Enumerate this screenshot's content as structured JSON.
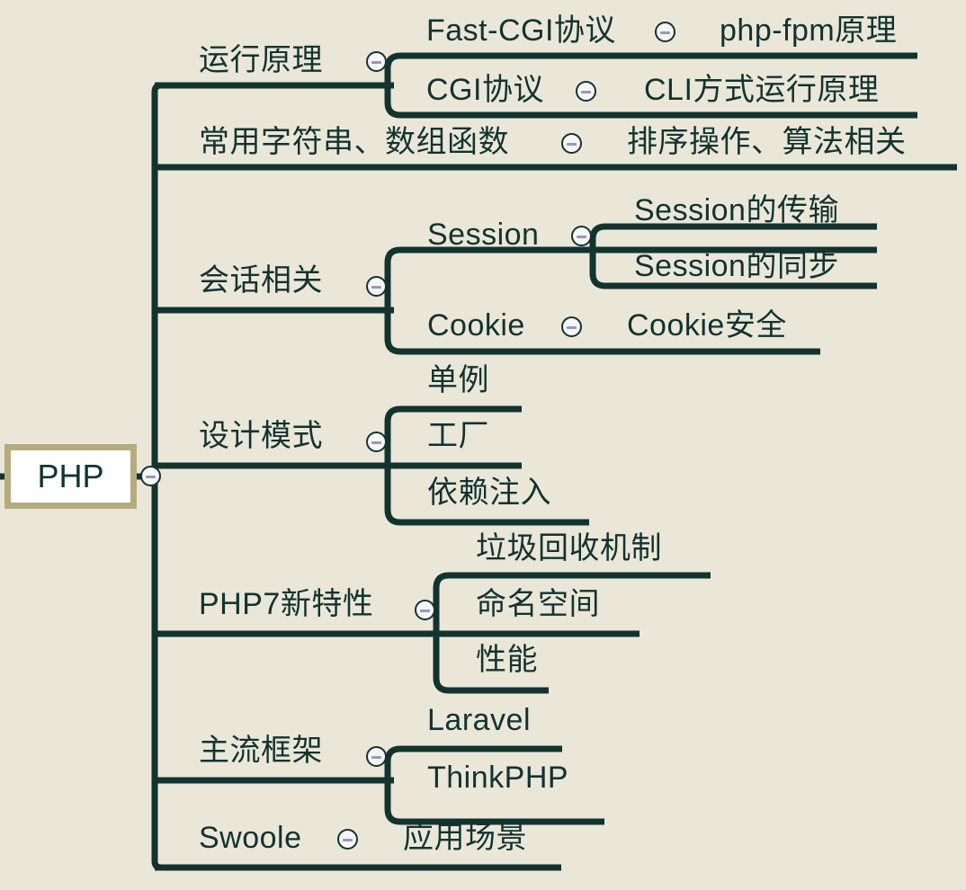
{
  "document": {
    "type": "mind-map",
    "title": "PHP",
    "background_color": "#eae7d9",
    "line_color": "#13332f",
    "text_color": "#13332f",
    "root_fill_color": "#ffffff",
    "root_border_color": "#b5ac7e",
    "toggle_icon": "collapse-minus-icon"
  },
  "root": {
    "label": "PHP"
  },
  "branches": [
    {
      "label": "运行原理",
      "children": [
        {
          "label": "Fast-CGI协议",
          "children": [
            {
              "label": "php-fpm原理"
            }
          ]
        },
        {
          "label": "CGI协议",
          "children": [
            {
              "label": "CLI方式运行原理"
            }
          ]
        }
      ]
    },
    {
      "label": "常用字符串、数组函数",
      "children": [
        {
          "label": "排序操作、算法相关"
        }
      ]
    },
    {
      "label": "会话相关",
      "children": [
        {
          "label": "Session",
          "children": [
            {
              "label": "Session的传输"
            },
            {
              "label": "Session的同步"
            }
          ]
        },
        {
          "label": "Cookie",
          "children": [
            {
              "label": "Cookie安全"
            }
          ]
        }
      ]
    },
    {
      "label": "设计模式",
      "children": [
        {
          "label": "单例"
        },
        {
          "label": "工厂"
        },
        {
          "label": "依赖注入"
        }
      ]
    },
    {
      "label": "PHP7新特性",
      "children": [
        {
          "label": "垃圾回收机制"
        },
        {
          "label": "命名空间"
        },
        {
          "label": "性能"
        }
      ]
    },
    {
      "label": "主流框架",
      "children": [
        {
          "label": "Laravel"
        },
        {
          "label": "ThinkPHP"
        }
      ]
    },
    {
      "label": "Swoole",
      "children": [
        {
          "label": "应用场景"
        }
      ]
    }
  ],
  "labels": {
    "root": "PHP",
    "b0": "运行原理",
    "b0c0": "Fast-CGI协议",
    "b0c0g0": "php-fpm原理",
    "b0c1": "CGI协议",
    "b0c1g0": "CLI方式运行原理",
    "b1": "常用字符串、数组函数",
    "b1c0": "排序操作、算法相关",
    "b2": "会话相关",
    "b2c0": "Session",
    "b2c0g0": "Session的传输",
    "b2c0g1": "Session的同步",
    "b2c1": "Cookie",
    "b2c1g0": "Cookie安全",
    "b3": "设计模式",
    "b3c0": "单例",
    "b3c1": "工厂",
    "b3c2": "依赖注入",
    "b4": "PHP7新特性",
    "b4c0": "垃圾回收机制",
    "b4c1": "命名空间",
    "b4c2": "性能",
    "b5": "主流框架",
    "b5c0": "Laravel",
    "b5c1": "ThinkPHP",
    "b6": "Swoole",
    "b6c0": "应用场景"
  }
}
